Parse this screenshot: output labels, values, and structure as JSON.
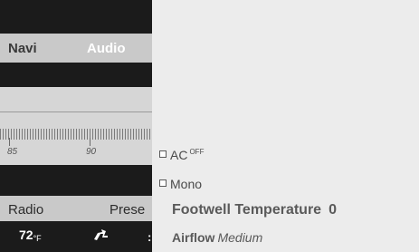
{
  "audio_screen": {
    "nav": {
      "navi_label": "Navi",
      "audio_label": "Audio"
    },
    "frequency_scale": {
      "tick_labels": [
        "85",
        "90"
      ]
    },
    "bottom_bar": {
      "radio_label": "Radio",
      "presets_label": "Prese"
    },
    "climate_bar": {
      "temperature": "72",
      "unit": "°F"
    }
  },
  "menu": {
    "ac": {
      "label": "AC",
      "state": "OFF"
    },
    "mono": {
      "label": "Mono"
    },
    "footwell": {
      "label": "Footwell Temperature",
      "value": "0"
    },
    "airflow": {
      "label": "Airflow",
      "value": "Medium"
    }
  },
  "icons": {
    "seat_icon": "seat-icon",
    "checkbox_icon": "checkbox-icon"
  },
  "colors": {
    "screen_dark": "#1b1b1b",
    "bar_gray": "#c9c9c9",
    "menu_bg": "#ececec",
    "menu_text": "#4a4a4a",
    "active_text": "#ffffff"
  }
}
